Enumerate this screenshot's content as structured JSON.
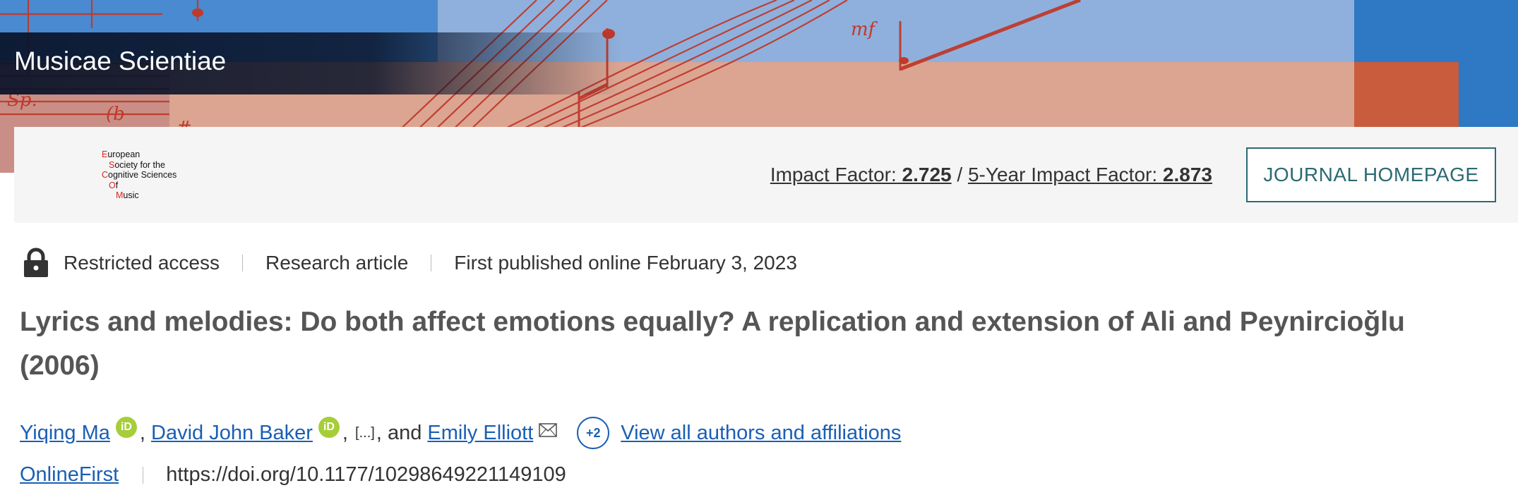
{
  "banner": {
    "journal_title": "Musicae Scientiae",
    "colors": {
      "blue": "#8fb0dc",
      "salmon": "#dba592",
      "dark_blue": "#2e78c4",
      "dark_salmon": "#c85c3c",
      "staff_red": "#c0392b"
    }
  },
  "society_logo": {
    "lines": [
      {
        "cap": "E",
        "rest": "uropean"
      },
      {
        "cap": "S",
        "rest": "ociety for the"
      },
      {
        "cap": "C",
        "rest": "ognitive Sciences"
      },
      {
        "cap": "O",
        "rest": "f"
      },
      {
        "cap": "M",
        "rest": "usic"
      }
    ]
  },
  "impact": {
    "if_label": "Impact Factor: ",
    "if_value": "2.725",
    "divider": " / ",
    "five_year_label": "5-Year Impact Factor: ",
    "five_year_value": "2.873"
  },
  "journal_homepage_button": "JOURNAL HOMEPAGE",
  "meta": {
    "access": "Restricted access",
    "article_type": "Research article",
    "published": "First published online February 3, 2023"
  },
  "article_title": "Lyrics and melodies: Do both affect emotions equally? A replication and extension of Ali and Peynircioğlu (2006)",
  "authors": {
    "author1": "Yiqing Ma",
    "author2": "David John Baker",
    "comma1": ",",
    "comma2": ",",
    "ellipsis": "[...]",
    "and_text": ", and",
    "author3": "Emily Elliott",
    "more_count": "+2",
    "view_all": "View all authors and affiliations",
    "orcid_label": "iD"
  },
  "publication": {
    "status": "OnlineFirst",
    "doi": "https://doi.org/10.1177/10298649221149109"
  }
}
